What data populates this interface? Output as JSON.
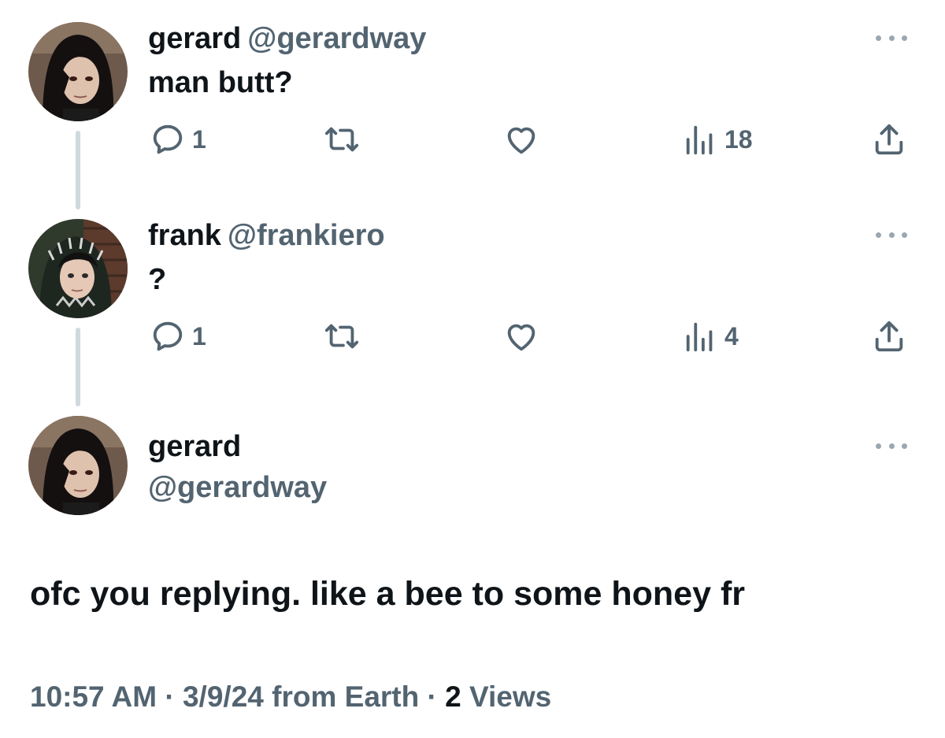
{
  "tweets": [
    {
      "display_name": "gerard",
      "handle": "@gerardway",
      "text": "man butt?",
      "avatar": "gerard-avatar",
      "actions": {
        "replies": "1",
        "reposts": "",
        "likes": "",
        "views": "18"
      }
    },
    {
      "display_name": "frank",
      "handle": "@frankiero",
      "text": "?",
      "avatar": "frank-avatar",
      "actions": {
        "replies": "1",
        "reposts": "",
        "likes": "",
        "views": "4"
      }
    }
  ],
  "main_tweet": {
    "display_name": "gerard",
    "handle": "@gerardway",
    "text": "ofc you replying. like a bee to some honey fr",
    "time": "10:57 AM",
    "separator": "·",
    "date": "3/9/24 from Earth",
    "views_count": "2",
    "views_label": "Views"
  },
  "icons": {
    "reply": "reply-icon",
    "repost": "repost-icon",
    "like": "like-icon",
    "views": "views-icon",
    "share": "share-icon",
    "more": "more-icon"
  },
  "colors": {
    "text_primary": "#0f1419",
    "text_secondary": "#536471",
    "thread_line": "#cfd9de"
  }
}
